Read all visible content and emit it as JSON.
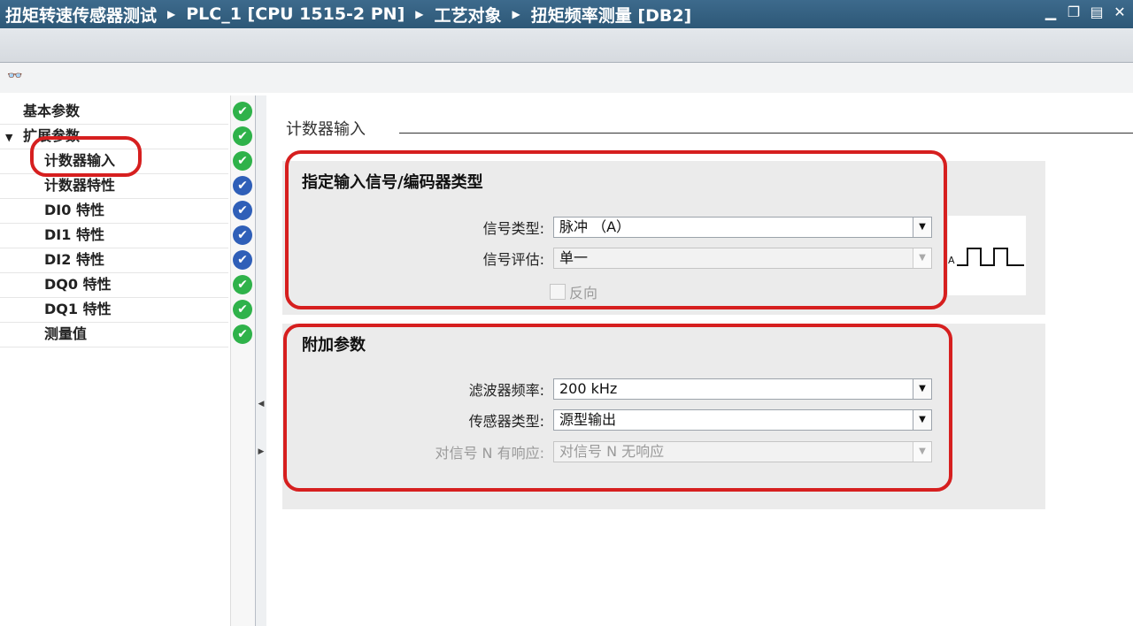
{
  "breadcrumb": [
    "扭矩转速传感器测试",
    "PLC_1 [CPU 1515-2 PN]",
    "工艺对象",
    "扭矩频率测量 [DB2]"
  ],
  "window_icons": [
    "minimize-icon",
    "restore-icon",
    "maximize-icon",
    "close-icon"
  ],
  "nav": {
    "items": [
      {
        "label": "基本参数",
        "status": "ok"
      },
      {
        "label": "扩展参数",
        "status": "ok",
        "expand": "▼"
      },
      {
        "label": "计数器输入",
        "status": "ok"
      },
      {
        "label": "计数器特性",
        "status": "info"
      },
      {
        "label": "DI0 特性",
        "status": "info"
      },
      {
        "label": "DI1 特性",
        "status": "info"
      },
      {
        "label": "DI2 特性",
        "status": "info"
      },
      {
        "label": "DQ0 特性",
        "status": "ok"
      },
      {
        "label": "DQ1 特性",
        "status": "ok"
      },
      {
        "label": "测量值",
        "status": "ok"
      }
    ],
    "status_glyphs": {
      "ok": "✔",
      "info": "✔"
    }
  },
  "section": {
    "title": "计数器输入"
  },
  "panel1": {
    "title": "指定输入信号/编码器类型",
    "signal_type": {
      "label": "信号类型:",
      "value": "脉冲 （A）"
    },
    "signal_eval": {
      "label": "信号评估:",
      "value": "单一"
    },
    "reverse": {
      "label": "反向"
    },
    "wave_label": "A"
  },
  "panel2": {
    "title": "附加参数",
    "filter_freq": {
      "label": "滤波器频率:",
      "value": "200 kHz"
    },
    "sensor_type": {
      "label": "传感器类型:",
      "value": "源型输出"
    },
    "signal_n": {
      "label": "对信号 N 有响应:",
      "value": "对信号 N 无响应"
    }
  },
  "colors": {
    "ok": "#2fb24a",
    "info": "#2f5fb8",
    "annotation": "#d61f1f",
    "titlebar": "#2d5877"
  }
}
